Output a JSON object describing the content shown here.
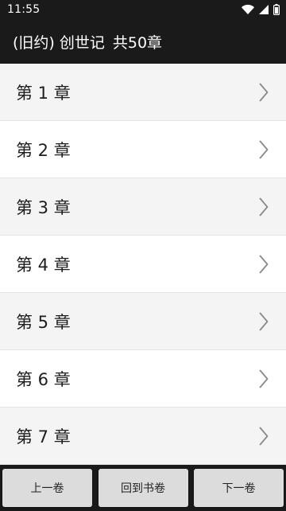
{
  "status_bar": {
    "time": "11:55",
    "icons": [
      "wifi-icon",
      "signal-icon",
      "battery-icon"
    ]
  },
  "app_bar": {
    "title": "(旧约) 创世记",
    "chapter_count": "共50章"
  },
  "chapters": [
    {
      "label": "第 1 章"
    },
    {
      "label": "第 2 章"
    },
    {
      "label": "第 3 章"
    },
    {
      "label": "第 4 章"
    },
    {
      "label": "第 5 章"
    },
    {
      "label": "第 6 章"
    },
    {
      "label": "第 7 章"
    }
  ],
  "bottom_bar": {
    "prev_label": "上一卷",
    "back_label": "回到书卷",
    "next_label": "下一卷"
  },
  "colors": {
    "bar_background": "#1a1a1a",
    "row_odd": "#f4f4f4",
    "row_even": "#ffffff",
    "button_background": "#dcdcdc",
    "chevron": "#8a8a8a"
  }
}
